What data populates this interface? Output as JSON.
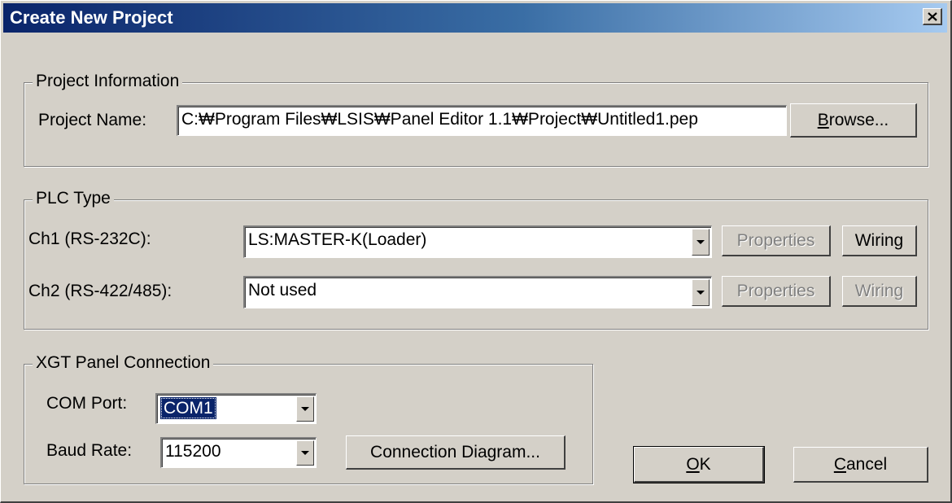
{
  "window": {
    "title": "Create New Project",
    "close_glyph": "✕"
  },
  "project_info": {
    "legend": "Project Information",
    "name_label": "Project Name:",
    "name_value": "C:₩Program Files₩LSIS₩Panel Editor 1.1₩Project₩Untitled1.pep",
    "browse_mnemonic": "B",
    "browse_rest": "rowse..."
  },
  "plc_type": {
    "legend": "PLC Type",
    "ch1": {
      "label": "Ch1 (RS-232C):",
      "value": "LS:MASTER-K(Loader)",
      "properties_label": "Properties",
      "wiring_label": "Wiring"
    },
    "ch2": {
      "label": "Ch2 (RS-422/485):",
      "value": "Not used",
      "properties_label": "Properties",
      "wiring_label": "Wiring"
    }
  },
  "xgt_connection": {
    "legend": "XGT Panel Connection",
    "com_label": "COM Port:",
    "com_value": "COM1",
    "baud_label": "Baud Rate:",
    "baud_value": "115200",
    "diagram_label": "Connection Diagram..."
  },
  "footer": {
    "ok_mnemonic": "O",
    "ok_rest": "K",
    "cancel_mnemonic": "C",
    "cancel_rest": "ancel"
  },
  "icons": {
    "dropdown": "dropdown-arrow-icon",
    "close": "close-icon"
  },
  "colors": {
    "title_start": "#0a246a",
    "title_end": "#a6caf0",
    "face": "#d4d0c8",
    "selection": "#0a246a",
    "disabled_text": "#808080"
  }
}
